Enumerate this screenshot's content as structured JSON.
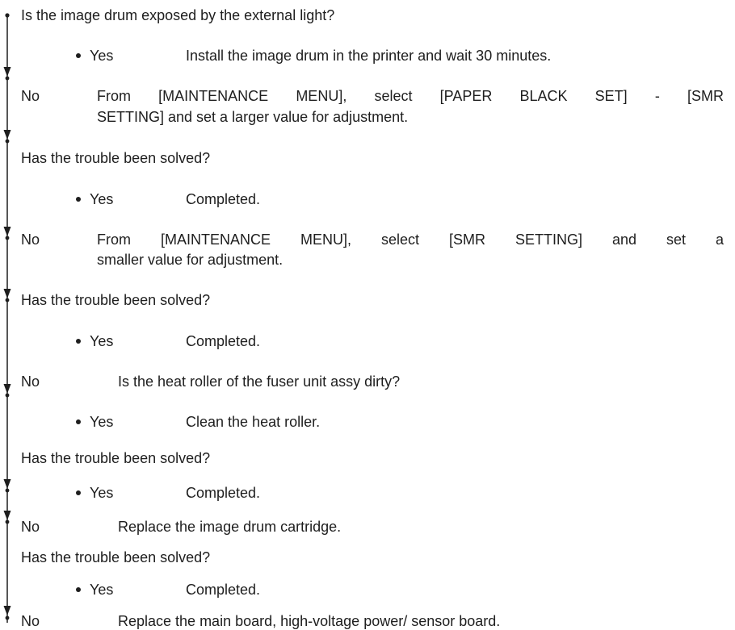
{
  "steps": {
    "q1": "Is the image drum exposed by the external light?",
    "q1_yes": {
      "answer": "Yes",
      "action": "Install the image drum in the printer and wait 30 minutes."
    },
    "q1_no": {
      "answer": "No",
      "action_line1": "From [MAINTENANCE MENU], select [PAPER BLACK SET] - [SMR",
      "action_line2": "SETTING] and set a larger value for adjustment."
    },
    "q2": "Has the trouble been solved?",
    "q2_yes": {
      "answer": "Yes",
      "action": "Completed."
    },
    "q2_no": {
      "answer": "No",
      "action_line1": "From [MAINTENANCE MENU], select [SMR SETTING] and set a",
      "action_line2": "smaller value for adjustment."
    },
    "q3": "Has the trouble been solved?",
    "q3_yes": {
      "answer": "Yes",
      "action": "Completed."
    },
    "q3_no": {
      "answer": "No",
      "action": "Is the heat roller of the fuser unit assy dirty?"
    },
    "q3_no_yes": {
      "answer": "Yes",
      "action": "Clean the heat roller."
    },
    "q4": "Has the trouble been solved?",
    "q4_yes": {
      "answer": "Yes",
      "action": "Completed."
    },
    "q4_no": {
      "answer": "No",
      "action": "Replace the image drum cartridge."
    },
    "q5": "Has the trouble been solved?",
    "q5_yes": {
      "answer": "Yes",
      "action": "Completed."
    },
    "q5_no": {
      "answer": "No",
      "action": "Replace the main board, high-voltage power/ sensor board."
    }
  }
}
